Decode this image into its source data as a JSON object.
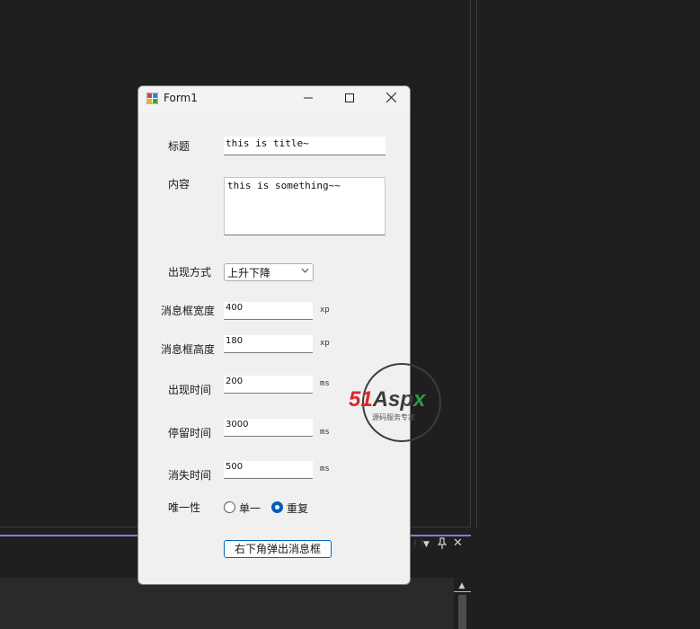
{
  "window": {
    "title": "Form1",
    "minimize_icon": "minimize-icon",
    "maximize_icon": "maximize-icon",
    "close_icon": "close-icon"
  },
  "form": {
    "title_label": "标题",
    "title_value": "this is title~",
    "content_label": "内容",
    "content_value": "this is something~~",
    "appear_mode_label": "出现方式",
    "appear_mode_value": "上升下降",
    "width_label": "消息框宽度",
    "width_value": "400",
    "width_unit": "xp",
    "height_label": "消息框高度",
    "height_value": "180",
    "height_unit": "xp",
    "show_time_label": "出现时间",
    "show_time_value": "200",
    "show_time_unit": "ms",
    "stay_time_label": "停留时间",
    "stay_time_value": "3000",
    "stay_time_unit": "ms",
    "hide_time_label": "消失时间",
    "hide_time_value": "500",
    "hide_time_unit": "ms",
    "unique_label": "唯一性",
    "radio_single": "单一",
    "radio_repeat": "重复",
    "selected_radio": "重复",
    "submit_button": "右下角弹出消息框"
  },
  "watermark": {
    "brand": "51Aspx",
    "tagline": "源码服务专家"
  },
  "colors": {
    "ide_background": "#1f1f1f",
    "accent": "#005fb8",
    "panel_accent": "#8a7ad0",
    "watermark_red": "#e0262c",
    "watermark_green": "#2e9a3e"
  }
}
